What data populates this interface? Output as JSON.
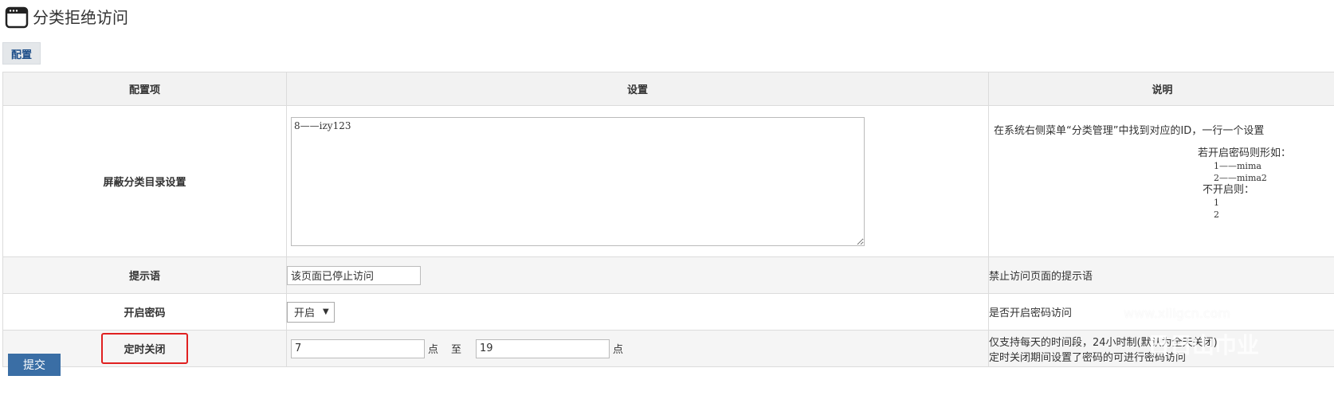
{
  "page": {
    "title": "分类拒绝访问",
    "icon": "browser-window-icon"
  },
  "tabs": [
    {
      "label": "配置"
    }
  ],
  "table": {
    "headers": [
      "配置项",
      "设置",
      "说明"
    ],
    "rows": {
      "shield": {
        "label": "屏蔽分类目录设置",
        "value": "8——izy123",
        "desc": "在系统右侧菜单“分类管理”中找到对应的ID，一行一个设置",
        "example_title": "若开启密码则形如：",
        "example_lines_pw": [
          "1——mima",
          "2——mima2"
        ],
        "example_title2": "不开启则：",
        "example_lines_nopw": [
          "1",
          "2"
        ]
      },
      "prompt": {
        "label": "提示语",
        "value": "该页面已停止访问",
        "desc": "禁止访问页面的提示语"
      },
      "password": {
        "label": "开启密码",
        "selected": "开启",
        "desc": "是否开启密码访问"
      },
      "timer": {
        "label": "定时关闭",
        "start": "7",
        "end": "19",
        "unit": "点",
        "sep": "至",
        "desc_line1": "仅支持每天的时间段，24小时制(默认为全天关闭)",
        "desc_line2": "定时关闭期间设置了密码的可进行密码访问"
      }
    }
  },
  "submit_label": "提交",
  "watermark": {
    "line1": "www.xiiigcn.com",
    "line2": "日日山巾业"
  },
  "colors": {
    "highlight_box": "#e02020",
    "submit_bg": "#3a6ea5",
    "tab_text": "#1d4e89"
  }
}
